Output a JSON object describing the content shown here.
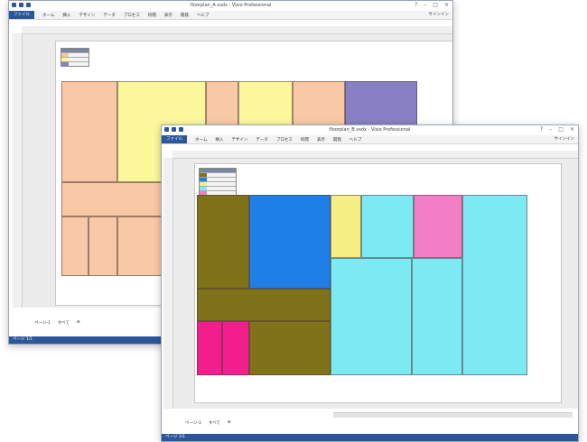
{
  "window_back": {
    "title": "floorplan_A.vsdx - Visio Professional",
    "ribbon_tabs": [
      "ファイル",
      "ホーム",
      "挿入",
      "デザイン",
      "データ",
      "プロセス",
      "校閲",
      "表示",
      "開発",
      "ヘルプ"
    ],
    "login_label": "サインイン",
    "page_tab": "ページ-1",
    "all_label": "すべて",
    "status": "ページ 1/1"
  },
  "window_front": {
    "title": "floorplan_B.vsdx - Visio Professional",
    "ribbon_tabs": [
      "ファイル",
      "ホーム",
      "挿入",
      "デザイン",
      "データ",
      "プロセス",
      "校閲",
      "表示",
      "開発",
      "ヘルプ"
    ],
    "login_label": "サインイン",
    "page_tab": "ページ-1",
    "all_label": "すべて",
    "status": "ページ 1/1"
  },
  "colors": {
    "peach": "#f9c8a4",
    "yellow": "#fbf79a",
    "purple": "#8880c4",
    "olive": "#7f7218",
    "blue": "#1e7fe8",
    "lightyellow": "#f5ef86",
    "cyan": "#7de9f2",
    "pink": "#f27ec6",
    "magenta": "#f21e8c",
    "accent": "#2b579a"
  }
}
